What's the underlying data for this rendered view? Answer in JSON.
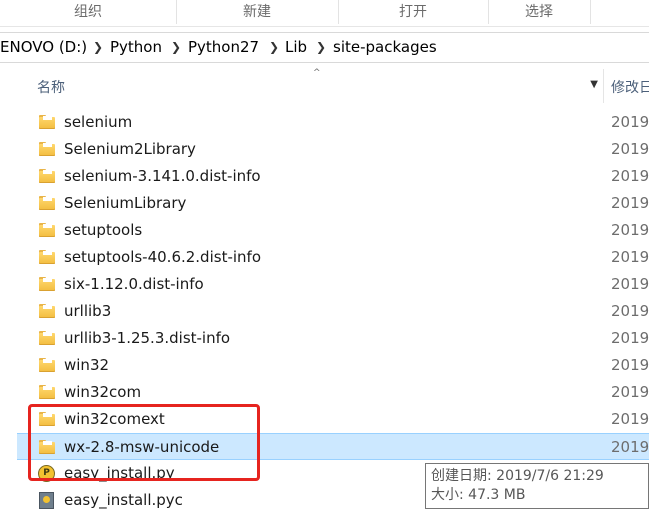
{
  "ribbon": {
    "groups": [
      "组织",
      "新建",
      "打开",
      "选择"
    ]
  },
  "address": {
    "crumbs": [
      "ENOVO (D:)",
      "Python",
      "Python27",
      "Lib",
      "site-packages"
    ],
    "separator": "❯"
  },
  "header": {
    "name_label": "名称",
    "modified_label": "修改日",
    "sort_arrow": "^",
    "dropdown_arrow": "▼"
  },
  "files": [
    {
      "name": "selenium",
      "date": "2019/",
      "icon": "folder-icon"
    },
    {
      "name": "Selenium2Library",
      "date": "2019/",
      "icon": "folder-icon"
    },
    {
      "name": "selenium-3.141.0.dist-info",
      "date": "2019/",
      "icon": "folder-icon"
    },
    {
      "name": "SeleniumLibrary",
      "date": "2019/",
      "icon": "folder-icon"
    },
    {
      "name": "setuptools",
      "date": "2019/",
      "icon": "folder-icon"
    },
    {
      "name": "setuptools-40.6.2.dist-info",
      "date": "2019/",
      "icon": "folder-icon"
    },
    {
      "name": "six-1.12.0.dist-info",
      "date": "2019/",
      "icon": "folder-icon"
    },
    {
      "name": "urllib3",
      "date": "2019/",
      "icon": "folder-icon"
    },
    {
      "name": "urllib3-1.25.3.dist-info",
      "date": "2019/",
      "icon": "folder-icon"
    },
    {
      "name": "win32",
      "date": "2019/",
      "icon": "folder-icon"
    },
    {
      "name": "win32com",
      "date": "2019/",
      "icon": "folder-icon"
    },
    {
      "name": "win32comext",
      "date": "2019/",
      "icon": "folder-icon"
    },
    {
      "name": "wx-2.8-msw-unicode",
      "date": "2019/",
      "icon": "folder-icon",
      "selected": true
    },
    {
      "name": "easy_install.py",
      "date": "",
      "icon": "python-file-icon"
    },
    {
      "name": "easy_install.pyc",
      "date": "",
      "icon": "python-compiled-icon"
    }
  ],
  "tooltip": {
    "created": "创建日期: 2019/7/6 21:29",
    "size": "大小: 47.3 MB"
  },
  "colors": {
    "selection": "#cce8ff",
    "annotation": "#e6241f",
    "folder": "#f3bd3f"
  }
}
